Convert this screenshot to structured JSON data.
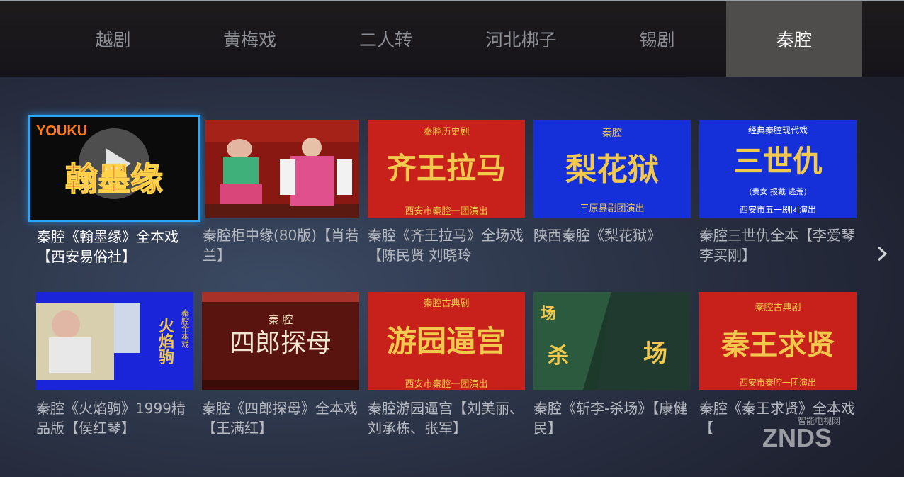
{
  "tabs": [
    {
      "label": "越剧"
    },
    {
      "label": "黄梅戏"
    },
    {
      "label": "二人转"
    },
    {
      "label": "河北梆子"
    },
    {
      "label": "锡剧"
    },
    {
      "label": "秦腔"
    }
  ],
  "active_tab": "秦腔",
  "cards": [
    {
      "caption": "秦腔《翰墨缘》全本戏【西安易俗社】",
      "poster_logo": "YOUKU",
      "poster_title": "翰墨缘",
      "poster_sub": "",
      "poster_top": ""
    },
    {
      "caption": "秦腔柜中缘(80版)【肖若兰】",
      "poster_title": "",
      "poster_sub": "",
      "poster_top": ""
    },
    {
      "caption": "秦腔《齐王拉马》全场戏【陈民贤 刘晓玲",
      "poster_top": "秦腔历史剧",
      "poster_title": "齐王拉马",
      "poster_sub": "西安市秦腔一团演出"
    },
    {
      "caption": "陕西秦腔《梨花狱》",
      "poster_top": "秦腔",
      "poster_title": "梨花狱",
      "poster_sub": "三原县剧团演出"
    },
    {
      "caption": "秦腔三世仇全本【李爱琴 李买刚】",
      "poster_top": "经典秦腔现代戏",
      "poster_title": "三世仇",
      "poster_mid": "(贵女 报戴 逃荒)",
      "poster_sub": "西安市五一剧团演出"
    },
    {
      "caption": "秦腔《火焰驹》1999精品版【侯红琴】",
      "poster_title": "火焰驹",
      "poster_side": "秦腔全本戏",
      "poster_top": "",
      "poster_sub": ""
    },
    {
      "caption": "秦腔《四郎探母》全本戏【王满红】",
      "poster_top": "秦 腔",
      "poster_title": "四郎探母",
      "poster_sub": ""
    },
    {
      "caption": "秦腔游园逼宫【刘美丽、刘承栋、张军】",
      "poster_top": "秦腔古典剧",
      "poster_title": "游园逼宫",
      "poster_sub": "西安市秦腔一团演出"
    },
    {
      "caption": "秦腔《斩李-杀场》【康健民】",
      "poster_title": "杀",
      "poster_title2": "场",
      "poster_corner": "场",
      "poster_top": "",
      "poster_sub": ""
    },
    {
      "caption": "秦腔《秦王求贤》全本戏【",
      "poster_top": "秦腔古典剧",
      "poster_title": "秦王求贤",
      "poster_sub": "西安市秦腔一团演出"
    }
  ],
  "watermark": {
    "text": "ZNDS",
    "sub": "智能电视网"
  },
  "colors": {
    "focus": "#2aa7ff",
    "active_tab_bg": "#4f4c4c",
    "poster_red": "#c8201a",
    "poster_blue": "#1530d8",
    "poster_gold": "#f2c94c"
  },
  "icons": {
    "next": "chevron-right-icon",
    "play": "play-icon"
  }
}
